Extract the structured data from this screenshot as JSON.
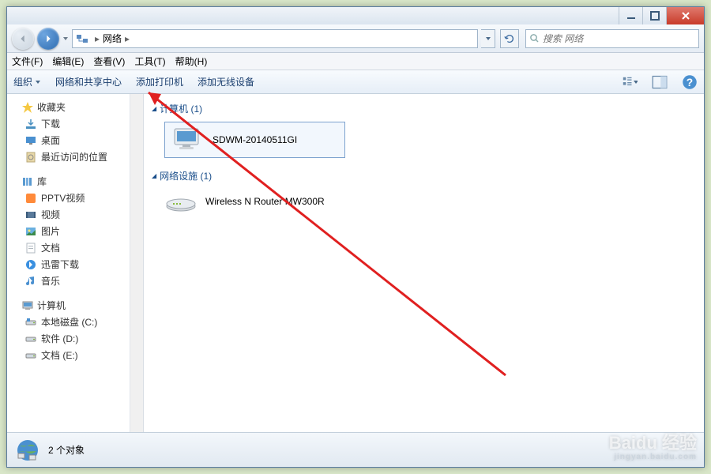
{
  "titlebar": {},
  "nav": {
    "breadcrumb_root": "网络",
    "search_placeholder": "搜索 网络"
  },
  "menubar": {
    "file": "文件(F)",
    "edit": "编辑(E)",
    "view": "查看(V)",
    "tools": "工具(T)",
    "help": "帮助(H)"
  },
  "toolbar": {
    "organize": "组织",
    "network_center": "网络和共享中心",
    "add_printer": "添加打印机",
    "add_wireless": "添加无线设备"
  },
  "sidebar": {
    "favorites": {
      "label": "收藏夹",
      "items": [
        {
          "label": "下载",
          "icon": "download"
        },
        {
          "label": "桌面",
          "icon": "desktop"
        },
        {
          "label": "最近访问的位置",
          "icon": "recent"
        }
      ]
    },
    "libraries": {
      "label": "库",
      "items": [
        {
          "label": "PPTV视频",
          "icon": "pptv"
        },
        {
          "label": "视频",
          "icon": "video"
        },
        {
          "label": "图片",
          "icon": "pictures"
        },
        {
          "label": "文档",
          "icon": "documents"
        },
        {
          "label": "迅雷下载",
          "icon": "xunlei"
        },
        {
          "label": "音乐",
          "icon": "music"
        }
      ]
    },
    "computer": {
      "label": "计算机",
      "items": [
        {
          "label": "本地磁盘 (C:)",
          "icon": "drive-c"
        },
        {
          "label": "软件 (D:)",
          "icon": "drive"
        },
        {
          "label": "文档 (E:)",
          "icon": "drive"
        }
      ]
    }
  },
  "content": {
    "computers": {
      "header": "计算机 (1)",
      "items": [
        {
          "name": "SDWM-20140511GI"
        }
      ]
    },
    "infrastructure": {
      "header": "网络设施 (1)",
      "items": [
        {
          "name": "Wireless N Router MW300R"
        }
      ]
    }
  },
  "statusbar": {
    "text": "2 个对象"
  },
  "watermark": {
    "main": "Baidu 经验",
    "sub": "jingyan.baidu.com"
  }
}
